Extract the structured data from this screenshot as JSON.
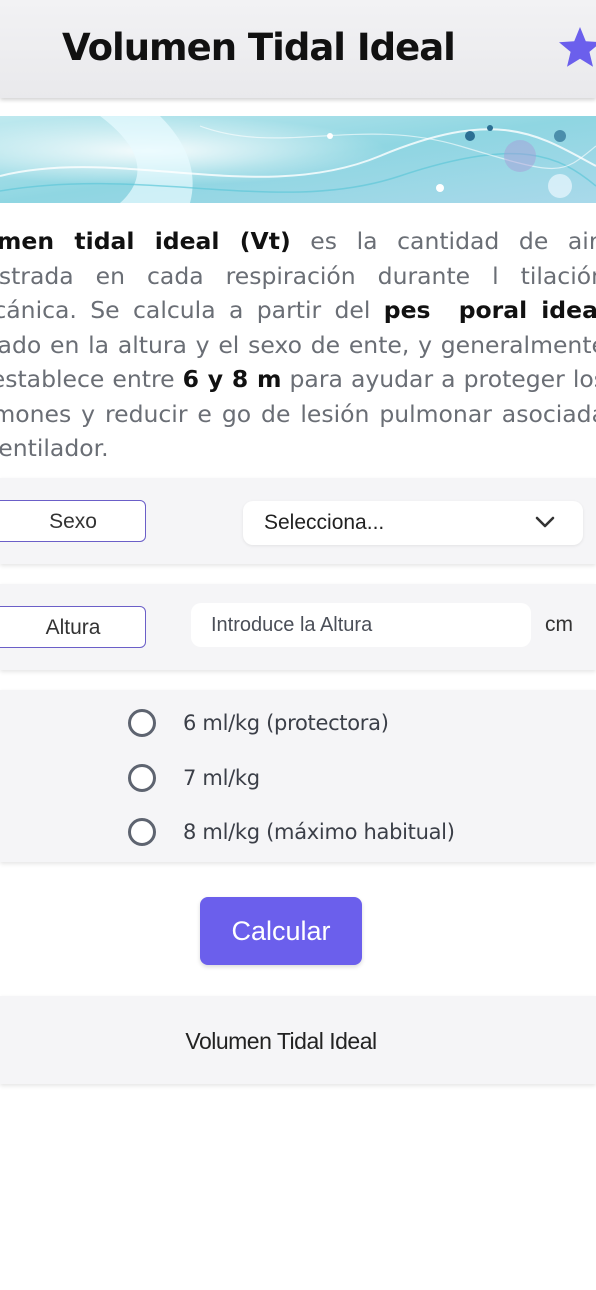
{
  "header": {
    "title": "Volumen Tidal Ideal",
    "favorite_icon": "star-icon",
    "accent": "#6b5fec"
  },
  "banner": {
    "image": "lungs-abstract-illustration"
  },
  "description": {
    "part1_bold": "olumen tidal ideal (Vt)",
    "part2": " es la cantidad de air  ninistrada en cada respiración durante l tilación mecánica. Se calcula a partir del ",
    "part3_bold": "pes  poral ideal",
    "part4": " basado en la altura y el sexo de ente, y generalmente se establece entre ",
    "part5_bold": "6 y 8 m",
    "part6": " para ayudar a proteger los pulmones y reducir e go de lesión pulmonar asociada al ventilador."
  },
  "sex_field": {
    "label": "Sexo",
    "selected": "Selecciona..."
  },
  "height_field": {
    "label": "Altura",
    "placeholder": "Introduce la Altura",
    "unit": "cm"
  },
  "ratio_options": [
    {
      "label": "6 ml/kg (protectora)"
    },
    {
      "label": "7 ml/kg"
    },
    {
      "label": "8 ml/kg (máximo habitual)"
    }
  ],
  "calculate_label": "Calcular",
  "result_label": "Volumen Tidal Ideal"
}
